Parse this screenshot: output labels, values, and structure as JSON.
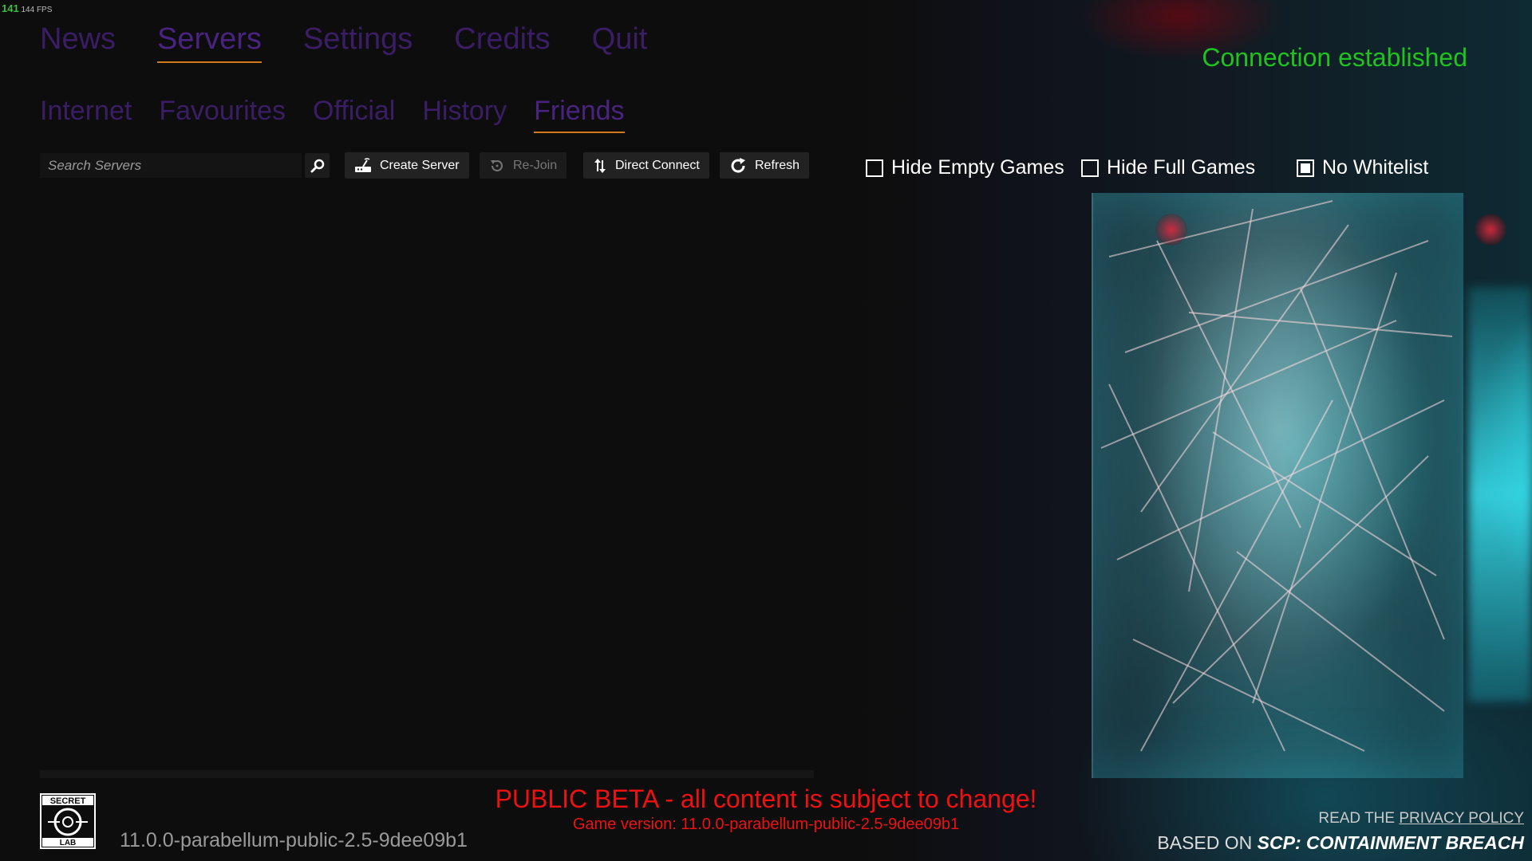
{
  "fps": {
    "value": "141",
    "label": "144 FPS"
  },
  "nav": {
    "items": [
      {
        "label": "News"
      },
      {
        "label": "Servers"
      },
      {
        "label": "Settings"
      },
      {
        "label": "Credits"
      },
      {
        "label": "Quit"
      }
    ],
    "active": "Servers"
  },
  "subnav": {
    "items": [
      {
        "label": "Internet"
      },
      {
        "label": "Favourites"
      },
      {
        "label": "Official"
      },
      {
        "label": "History"
      },
      {
        "label": "Friends"
      }
    ],
    "active": "Friends"
  },
  "status": {
    "connection": "Connection established",
    "color": "#1fc21f"
  },
  "toolbar": {
    "search_placeholder": "Search Servers",
    "create_label": "Create Server",
    "rejoin_label": "Re-Join",
    "direct_label": "Direct Connect",
    "refresh_label": "Refresh"
  },
  "filters": {
    "hide_empty": {
      "label": "Hide Empty Games",
      "checked": false
    },
    "hide_full": {
      "label": "Hide Full Games",
      "checked": false
    },
    "no_whitelist": {
      "label": "No Whitelist",
      "checked": true
    }
  },
  "footer": {
    "logo_top": "SECRET",
    "logo_bottom": "LAB",
    "version": "11.0.0-parabellum-public-2.5-9dee09b1",
    "beta_notice": "PUBLIC BETA - all content is subject to change!",
    "game_version": "Game version: 11.0.0-parabellum-public-2.5-9dee09b1",
    "privacy_prefix": "READ THE",
    "privacy_link": "PRIVACY POLICY",
    "based_prefix": "BASED ON",
    "based_title": "SCP: CONTAINMENT BREACH"
  },
  "colors": {
    "accent_underline": "#d27a1a",
    "nav_text": "#3b1d66",
    "beta_red": "#ee1111"
  }
}
